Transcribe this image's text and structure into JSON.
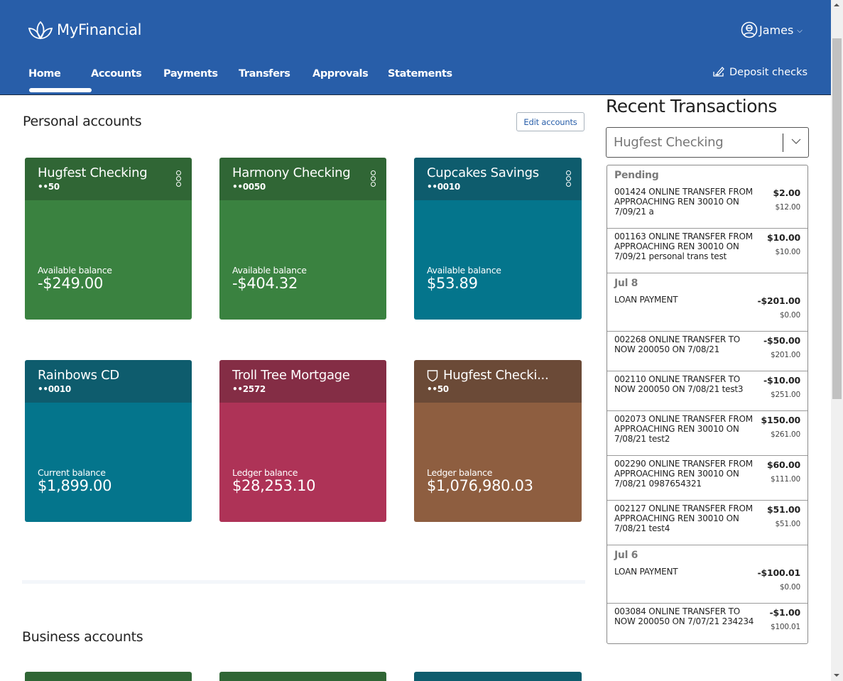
{
  "app": {
    "brand": "MyFinancial",
    "user_name": "James"
  },
  "nav": {
    "items": [
      {
        "label": "Home",
        "active": true
      },
      {
        "label": "Accounts"
      },
      {
        "label": "Payments"
      },
      {
        "label": "Transfers"
      },
      {
        "label": "Approvals"
      },
      {
        "label": "Statements"
      }
    ],
    "deposit_label": "Deposit checks"
  },
  "personal": {
    "title": "Personal accounts",
    "edit_label": "Edit accounts",
    "accounts": [
      {
        "name": "Hugfest Checking",
        "number": "••50",
        "balance_label": "Available balance",
        "balance": "-$249.00",
        "head_color": "#306635",
        "body_color": "#3a8240",
        "menu": true
      },
      {
        "name": "Harmony Checking",
        "number": "••0050",
        "balance_label": "Available balance",
        "balance": "-$404.32",
        "head_color": "#306635",
        "body_color": "#3a8240",
        "menu": true
      },
      {
        "name": "Cupcakes Savings",
        "number": "••0010",
        "balance_label": "Available balance",
        "balance": "$53.89",
        "head_color": "#0e5c6d",
        "body_color": "#04758c",
        "menu": true
      },
      {
        "name": "Rainbows CD",
        "number": "••0010",
        "balance_label": "Current balance",
        "balance": "$1,899.00",
        "head_color": "#0e5c6d",
        "body_color": "#04758c",
        "menu": false
      },
      {
        "name": "Troll Tree Mortgage",
        "number": "••2572",
        "balance_label": "Ledger balance",
        "balance": "$28,253.10",
        "head_color": "#842d45",
        "body_color": "#ae3357",
        "menu": false
      },
      {
        "name": "Hugfest Checki...",
        "number": "••50",
        "balance_label": "Ledger balance",
        "balance": "$1,076,980.03",
        "head_color": "#6b4a37",
        "body_color": "#8e5e40",
        "menu": false,
        "shield": true
      }
    ]
  },
  "business": {
    "title": "Business accounts",
    "card_colors": [
      "#306635",
      "#306635",
      "#0e5c6d"
    ]
  },
  "recent": {
    "title": "Recent Transactions",
    "selected_account": "Hugfest Checking",
    "groups": [
      {
        "label": "Pending",
        "transactions": [
          {
            "desc": "001424 ONLINE TRANSFER FROM APPROACHING REN 30010 ON 7/09/21 a",
            "amount": "$2.00",
            "balance": "$12.00"
          },
          {
            "desc": "001163 ONLINE TRANSFER FROM APPROACHING REN 30010 ON 7/09/21 personal trans test",
            "amount": "$10.00",
            "balance": "$10.00"
          }
        ]
      },
      {
        "label": "Jul 8",
        "transactions": [
          {
            "desc": "LOAN PAYMENT",
            "amount": "-$201.00",
            "balance": "$0.00"
          },
          {
            "desc": "002268 ONLINE TRANSFER TO NOW 200050 ON 7/08/21",
            "amount": "-$50.00",
            "balance": "$201.00"
          },
          {
            "desc": "002110 ONLINE TRANSFER TO NOW 200050 ON 7/08/21 test3",
            "amount": "-$10.00",
            "balance": "$251.00"
          },
          {
            "desc": "002073 ONLINE TRANSFER FROM APPROACHING REN 30010 ON 7/08/21 test2",
            "amount": "$150.00",
            "balance": "$261.00"
          },
          {
            "desc": "002290 ONLINE TRANSFER FROM APPROACHING REN 30010 ON 7/08/21 0987654321",
            "amount": "$60.00",
            "balance": "$111.00"
          },
          {
            "desc": "002127 ONLINE TRANSFER FROM APPROACHING REN 30010 ON 7/08/21 test4",
            "amount": "$51.00",
            "balance": "$51.00"
          }
        ]
      },
      {
        "label": "Jul 6",
        "transactions": [
          {
            "desc": "LOAN PAYMENT",
            "amount": "-$100.01",
            "balance": "$0.00"
          },
          {
            "desc": "003084 ONLINE TRANSFER TO NOW 200050 ON 7/07/21 234234",
            "amount": "-$1.00",
            "balance": "$100.01"
          }
        ]
      }
    ]
  }
}
